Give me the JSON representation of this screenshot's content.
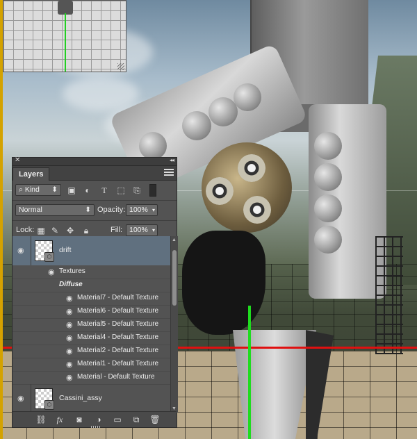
{
  "panel": {
    "title": "Layers",
    "filter": {
      "kind_label": "Kind"
    },
    "blend_mode": "Normal",
    "opacity_label": "Opacity:",
    "opacity_value": "100%",
    "lock_label": "Lock:",
    "fill_label": "Fill:",
    "fill_value": "100%",
    "layers": [
      {
        "name": "drift",
        "selected": true,
        "visible": true,
        "textures_label": "Textures",
        "diffuse_label": "Diffuse",
        "materials": [
          "Material7 - Default Texture",
          "Material6 - Default Texture",
          "Material5 - Default Texture",
          "Material4 - Default Texture",
          "Material2 - Default Texture",
          "Material1 - Default Texture",
          "Material - Default Texture"
        ]
      },
      {
        "name": "Cassini_assy",
        "selected": false,
        "visible": true
      }
    ],
    "bottom_icons": [
      "link-icon",
      "fx-icon",
      "add-mask-icon",
      "adjustment-icon",
      "folder-icon",
      "new-layer-icon",
      "trash-icon"
    ],
    "fx_glyph": "fx"
  },
  "colors": {
    "panel_bg": "#535353",
    "selected_row": "#60707f",
    "red_axis": "#e01010",
    "green_axis": "#1edc1e"
  }
}
